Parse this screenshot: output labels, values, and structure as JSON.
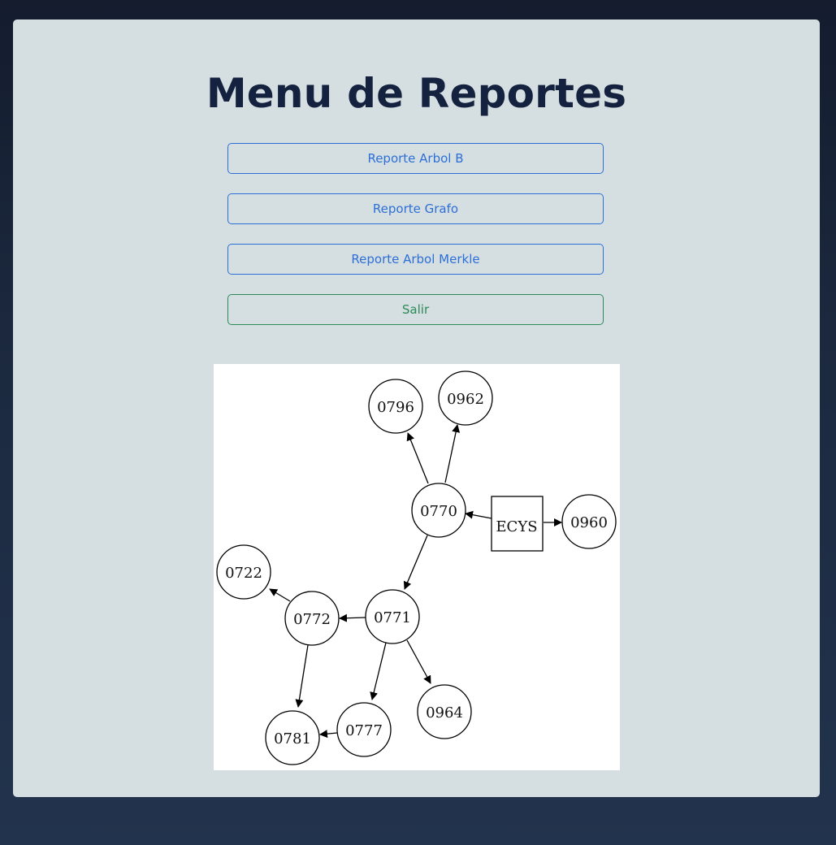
{
  "page": {
    "title": "Menu de Reportes"
  },
  "buttons": {
    "arbol_b": "Reporte Arbol B",
    "grafo": "Reporte Grafo",
    "arbol_merkle": "Reporte Arbol Merkle",
    "salir": "Salir"
  },
  "colors": {
    "primary": "#2d6fd6",
    "success": "#2b8a57",
    "title": "#14213f",
    "card_bg": "#d5dfe2"
  },
  "graph": {
    "nodes": [
      {
        "id": "n0796",
        "label": "0796",
        "shape": "circle"
      },
      {
        "id": "n0962",
        "label": "0962",
        "shape": "circle"
      },
      {
        "id": "n0770",
        "label": "0770",
        "shape": "circle"
      },
      {
        "id": "necys",
        "label": "ECYS",
        "shape": "box"
      },
      {
        "id": "n0960",
        "label": "0960",
        "shape": "circle"
      },
      {
        "id": "n0722",
        "label": "0722",
        "shape": "circle"
      },
      {
        "id": "n0772",
        "label": "0772",
        "shape": "circle"
      },
      {
        "id": "n0771",
        "label": "0771",
        "shape": "circle"
      },
      {
        "id": "n0964",
        "label": "0964",
        "shape": "circle"
      },
      {
        "id": "n0777",
        "label": "0777",
        "shape": "circle"
      },
      {
        "id": "n0781",
        "label": "0781",
        "shape": "circle"
      }
    ],
    "edges": [
      {
        "from": "ECYS",
        "to": "0770"
      },
      {
        "from": "ECYS",
        "to": "0960"
      },
      {
        "from": "0770",
        "to": "0796"
      },
      {
        "from": "0770",
        "to": "0962"
      },
      {
        "from": "0770",
        "to": "0771"
      },
      {
        "from": "0771",
        "to": "0772"
      },
      {
        "from": "0771",
        "to": "0777"
      },
      {
        "from": "0771",
        "to": "0964"
      },
      {
        "from": "0772",
        "to": "0722"
      },
      {
        "from": "0772",
        "to": "0781"
      },
      {
        "from": "0777",
        "to": "0781"
      }
    ]
  }
}
